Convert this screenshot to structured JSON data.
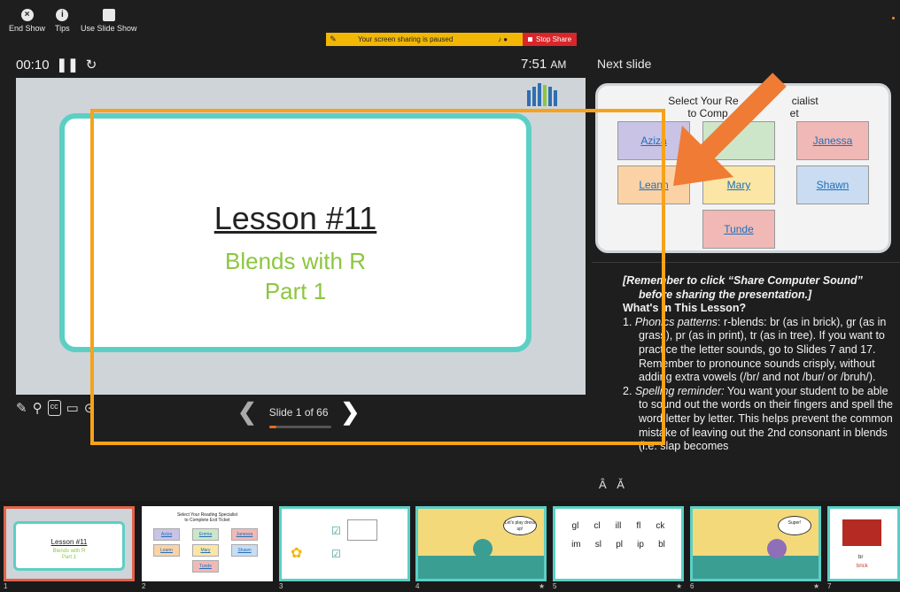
{
  "toolbar": {
    "end_show": "End Show",
    "tips": "Tips",
    "use_slide_show": "Use Slide Show"
  },
  "share_bar": {
    "message": "Your screen sharing is paused",
    "stop_share": "Stop Share"
  },
  "presenter": {
    "elapsed": "00:10",
    "clock": "7:51",
    "clock_suffix": "AM",
    "next_slide_label": "Next slide",
    "slide_counter": "Slide 1 of 66",
    "progress_fraction": 0.0152
  },
  "current_slide": {
    "title": "Lesson #11",
    "subtitle_line1": "Blends with R",
    "subtitle_line2": "Part 1"
  },
  "next_slide": {
    "title_line1": "Select Your Reading Specialist",
    "title_line2": "to Complete Exit Ticket",
    "visible_title_line1": "Select Your Re",
    "visible_title_line1b": "cialist",
    "visible_title_line2": "to Comp",
    "visible_title_line2b": "et",
    "tiles": [
      {
        "name": "Aziza",
        "color": "#c9c3e6"
      },
      {
        "name": "",
        "color": "#cde6c9"
      },
      {
        "name": "Janessa",
        "color": "#f0b9b6"
      },
      {
        "name": "Leann",
        "color": "#fbd2a6"
      },
      {
        "name": "Mary",
        "color": "#fbe6a6"
      },
      {
        "name": "Shawn",
        "color": "#c9dcf2"
      },
      {
        "name": "Tunde",
        "color": "#f0b9b6"
      }
    ]
  },
  "notes": {
    "reminder_line1": "[Remember to click “Share Computer Sound”",
    "reminder_line2": "before sharing the presentation.]",
    "heading": "What's in This Lesson?",
    "item1_label": "Phonics patterns",
    "item1_text": ": r-blends: br (as in brick), gr (as in grass), pr (as in print), tr (as in tree). If you want to practice the letter sounds, go to Slides 7 and 17. Remember to pronounce sounds crisply, without adding extra vowels (/br/ and not /bur/ or /bruh/).",
    "item2_label": "Spelling reminder:",
    "item2_text": " You want your student to be able to sound out the words on their fingers and spell the word letter by letter. This helps prevent the common mistake of leaving out the 2nd consonant in blends (i.e. slap becomes",
    "font_controls": "Â Ǎ"
  },
  "filmstrip": {
    "thumbs": [
      {
        "num": "1",
        "title": "Lesson #11",
        "sub1": "Blends with R",
        "sub2": "Part 1"
      },
      {
        "num": "2",
        "title1": "Select Your Reading Specialist",
        "title2": "to Complete Exit Ticket",
        "tiles": [
          "Aziza",
          "Emma",
          "Janessa",
          "Leann",
          "Mary",
          "Shawn",
          "Tunde"
        ]
      },
      {
        "num": "3"
      },
      {
        "num": "4",
        "bubble": "Let's play dress up!"
      },
      {
        "num": "5",
        "row1": [
          "gl",
          "cl",
          "ill",
          "fl",
          "ck"
        ],
        "row2": [
          "im",
          "sl",
          "pl",
          "ip",
          "bl"
        ]
      },
      {
        "num": "6",
        "bubble": "Super!"
      },
      {
        "num": "7",
        "word1": "br",
        "word2": "brick"
      }
    ]
  },
  "colors": {
    "accent_teal": "#5ccfc5",
    "accent_green": "#8cc63f",
    "annotation_orange": "#f6a21a",
    "arrow_orange": "#ef7b35",
    "stop_red": "#d9262a",
    "share_yellow": "#f2b705"
  }
}
